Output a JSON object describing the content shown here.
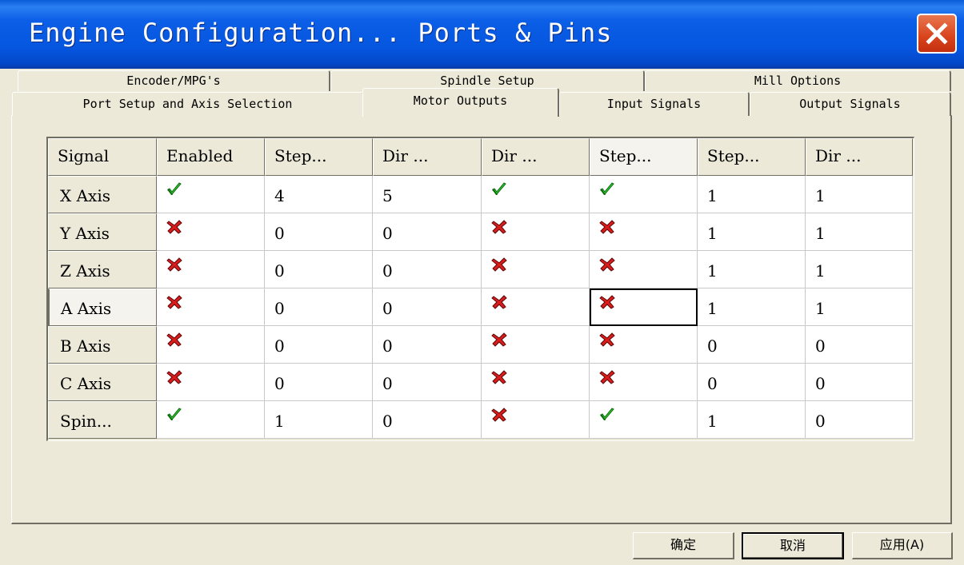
{
  "window": {
    "title": "Engine Configuration... Ports & Pins"
  },
  "tabs_back": [
    {
      "label": "Encoder/MPG's"
    },
    {
      "label": "Spindle Setup"
    },
    {
      "label": "Mill Options"
    }
  ],
  "tabs_front": [
    {
      "label": "Port Setup and Axis Selection"
    },
    {
      "label": "Motor Outputs"
    },
    {
      "label": "Input Signals"
    },
    {
      "label": "Output Signals"
    }
  ],
  "active_tab": "Motor Outputs",
  "grid": {
    "headers": [
      "Signal",
      "Enabled",
      "Step...",
      "Dir ...",
      "Dir ...",
      "Step...",
      "Step...",
      "Dir ..."
    ],
    "rows": [
      {
        "signal": "X Axis",
        "enabled": "check-icon",
        "step_pin": "4",
        "dir_pin": "5",
        "dir_low": "check-icon",
        "step_low": "check-icon",
        "step_port": "1",
        "dir_port": "1"
      },
      {
        "signal": "Y Axis",
        "enabled": "x-icon",
        "step_pin": "0",
        "dir_pin": "0",
        "dir_low": "x-icon",
        "step_low": "x-icon",
        "step_port": "1",
        "dir_port": "1"
      },
      {
        "signal": "Z Axis",
        "enabled": "x-icon",
        "step_pin": "0",
        "dir_pin": "0",
        "dir_low": "x-icon",
        "step_low": "x-icon",
        "step_port": "1",
        "dir_port": "1"
      },
      {
        "signal": "A Axis",
        "enabled": "x-icon",
        "step_pin": "0",
        "dir_pin": "0",
        "dir_low": "x-icon",
        "step_low": "x-icon",
        "step_port": "1",
        "dir_port": "1"
      },
      {
        "signal": "B Axis",
        "enabled": "x-icon",
        "step_pin": "0",
        "dir_pin": "0",
        "dir_low": "x-icon",
        "step_low": "x-icon",
        "step_port": "0",
        "dir_port": "0"
      },
      {
        "signal": "C Axis",
        "enabled": "x-icon",
        "step_pin": "0",
        "dir_pin": "0",
        "dir_low": "x-icon",
        "step_low": "x-icon",
        "step_port": "0",
        "dir_port": "0"
      },
      {
        "signal": "Spin...",
        "enabled": "check-icon",
        "step_pin": "1",
        "dir_pin": "0",
        "dir_low": "x-icon",
        "step_low": "check-icon",
        "step_port": "1",
        "dir_port": "0"
      }
    ],
    "selected_row": "A Axis",
    "focused_column": "Step..."
  },
  "buttons": {
    "ok": "确定",
    "cancel": "取消",
    "apply": "应用(A)"
  },
  "colors": {
    "titlebar": "#0656e0",
    "close": "#d8431c",
    "check": "#2fd22f",
    "x_mark": "#d91c1c",
    "face": "#ece9d8"
  }
}
